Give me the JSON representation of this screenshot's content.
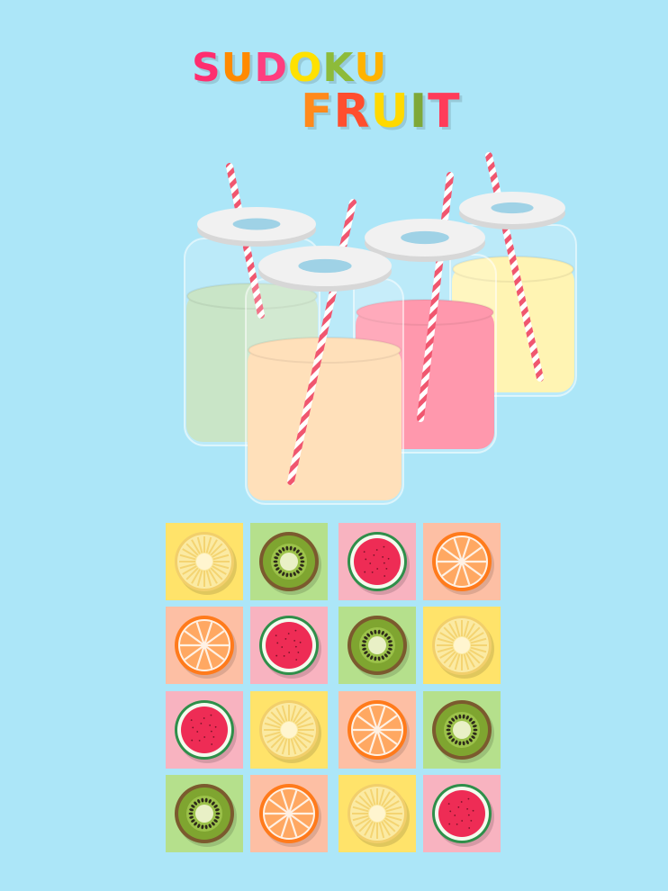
{
  "title": {
    "line1": [
      "S",
      "U",
      "D",
      "O",
      "K",
      "U"
    ],
    "line2": [
      "F",
      "R",
      "U",
      "I",
      "T"
    ]
  },
  "colors": {
    "background": "#ace6f8",
    "title_line1": [
      "#ff2d6f",
      "#ff8a00",
      "#ff3d7f",
      "#ffe100",
      "#8dbb3a",
      "#ffb300"
    ],
    "title_line2": [
      "#ff8a1c",
      "#ff4e2e",
      "#ffd900",
      "#7ea838",
      "#ff3c5a"
    ],
    "tile": {
      "pineapple": "#ffe36a",
      "kiwi": "#b5e08c",
      "watermelon": "#f8b3c0",
      "orange": "#fdbfa4"
    },
    "jars": [
      "#c9e5c7",
      "#ffe0ba",
      "#ff98ad",
      "#fff4b3"
    ],
    "straw": [
      "#ffffff",
      "#f0566f"
    ]
  },
  "jars": [
    {
      "name": "green",
      "drink": "#c9e5c7"
    },
    {
      "name": "pink",
      "drink": "#ff98ad"
    },
    {
      "name": "yellow",
      "drink": "#fff4b3"
    },
    {
      "name": "orange",
      "drink": "#ffe0ba"
    }
  ],
  "board": {
    "rows": 4,
    "cols": 4,
    "cells": [
      [
        "pineapple",
        "kiwi",
        "watermelon",
        "orange"
      ],
      [
        "orange",
        "watermelon",
        "kiwi",
        "pineapple"
      ],
      [
        "watermelon",
        "pineapple",
        "orange",
        "kiwi"
      ],
      [
        "kiwi",
        "orange",
        "pineapple",
        "watermelon"
      ]
    ]
  },
  "icons": {
    "pineapple": "pineapple-slice-icon",
    "kiwi": "kiwi-slice-icon",
    "watermelon": "watermelon-slice-icon",
    "orange": "orange-slice-icon"
  }
}
